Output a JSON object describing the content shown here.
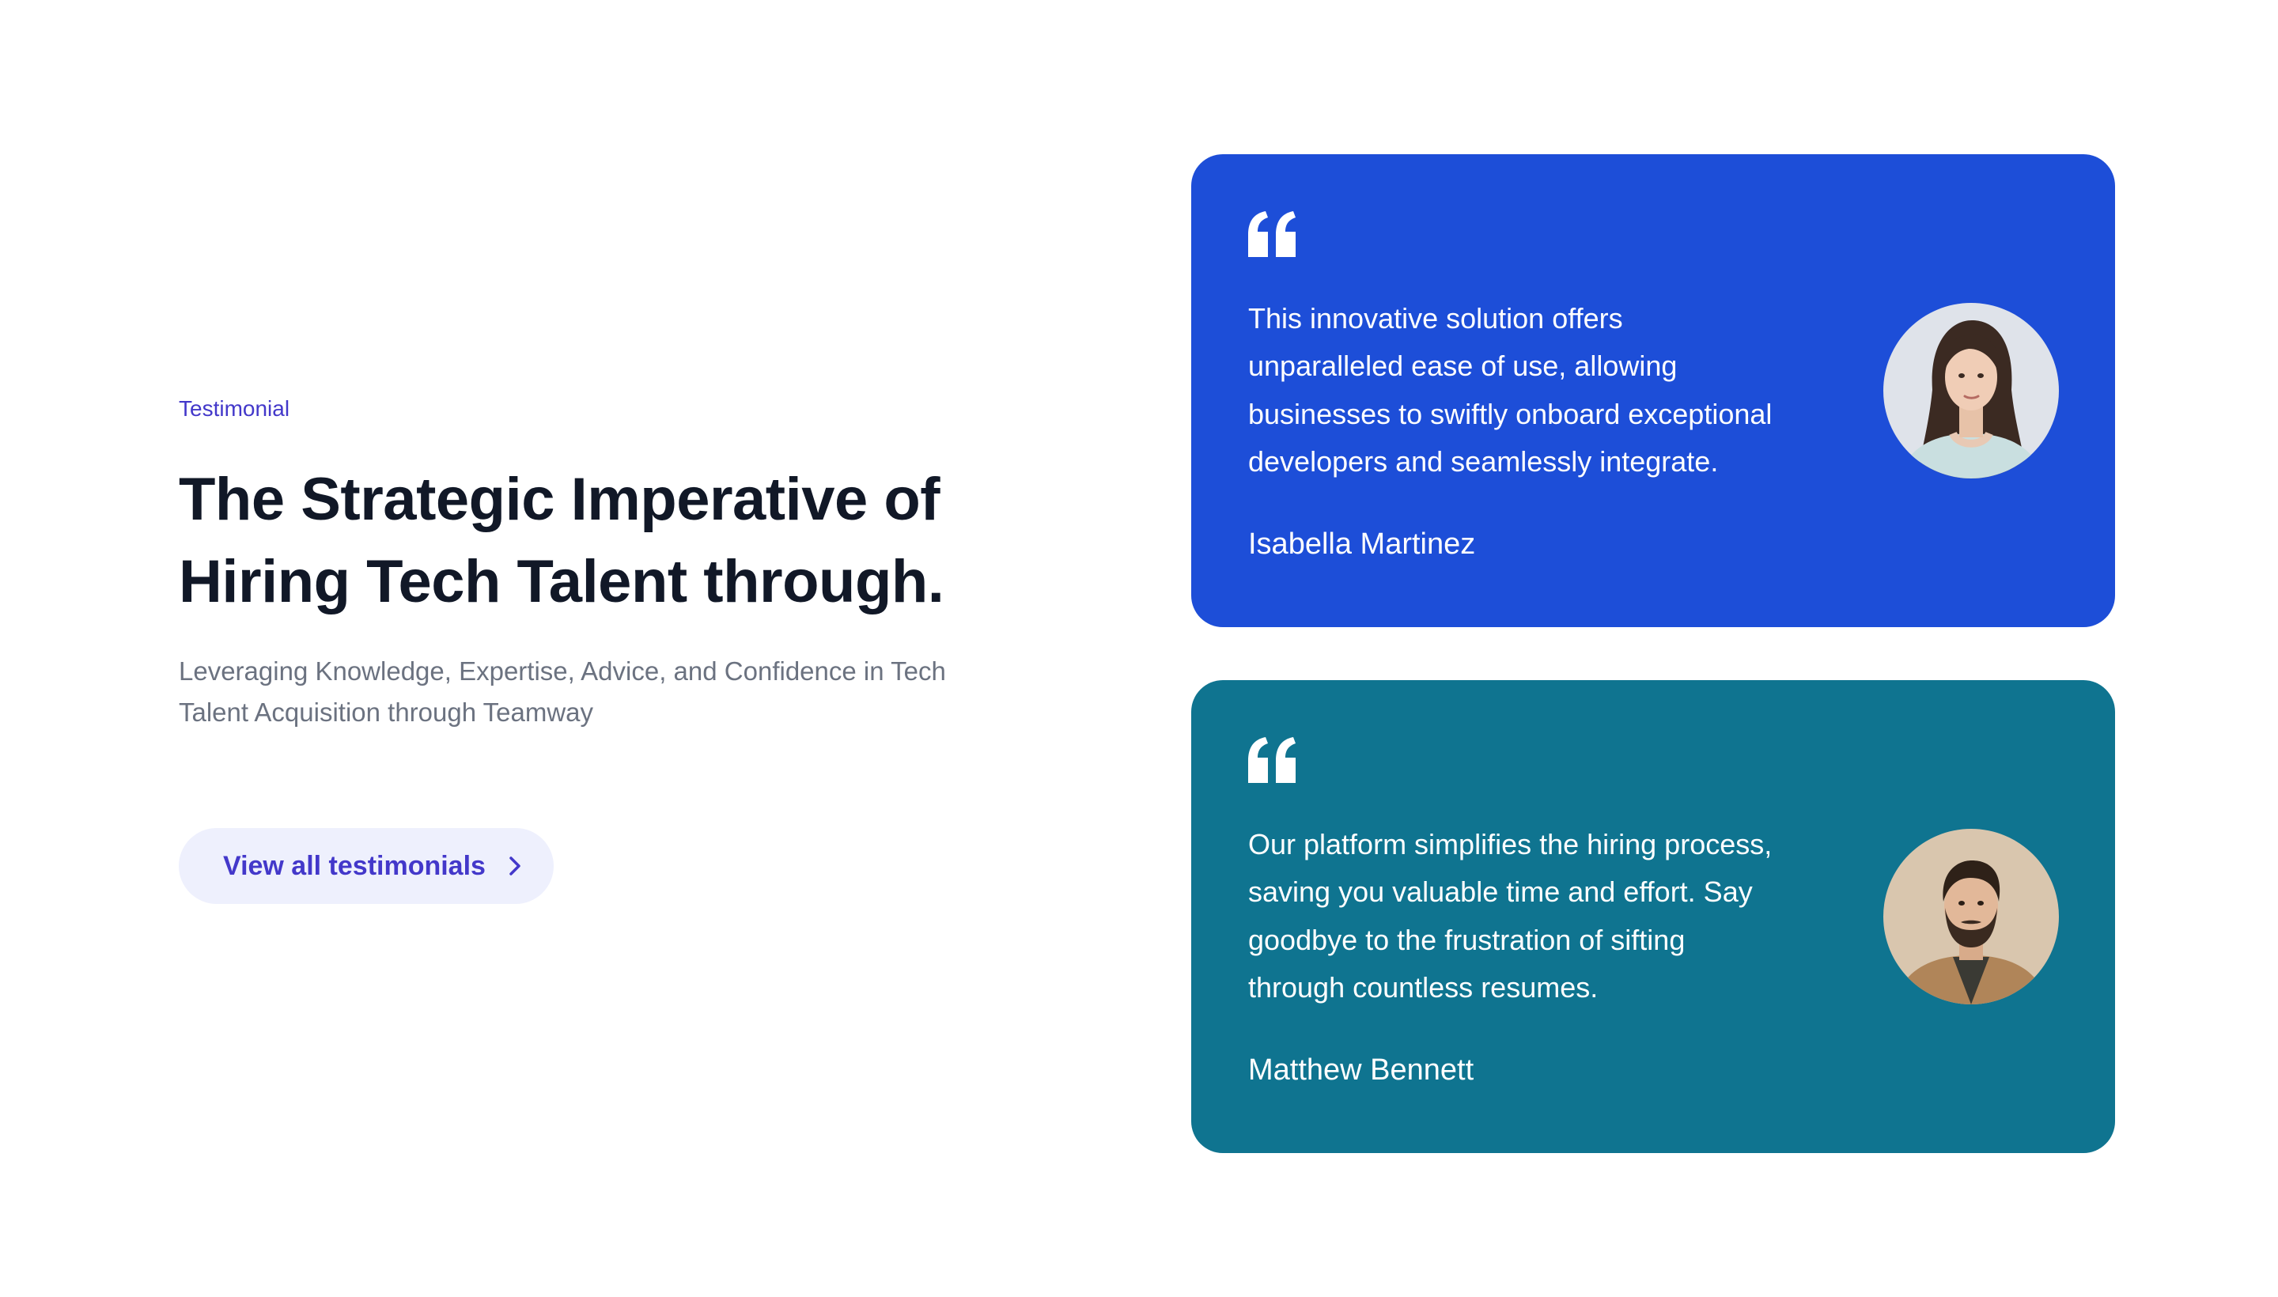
{
  "section": {
    "eyebrow": "Testimonial",
    "heading_line1": "The Strategic Imperative of",
    "heading_line2": "Hiring Tech Talent through.",
    "subtitle_line1": "Leveraging Knowledge, Expertise, Advice, and Confidence in Tech",
    "subtitle_line2": "Talent Acquisition through Teamway",
    "cta_label": "View all testimonials",
    "cta_icon": "chevron-right-icon"
  },
  "testimonials": [
    {
      "quote_line1": "This innovative solution offers",
      "quote_line2": "unparalleled ease of use, allowing",
      "quote_line3": "businesses to swiftly onboard exceptional",
      "quote_line4": "developers and seamlessly integrate.",
      "author": "Isabella Martinez",
      "background": "#1d4ed8",
      "icon": "quote-icon"
    },
    {
      "quote_line1": "Our platform simplifies the hiring process,",
      "quote_line2": "saving you valuable time and effort. Say",
      "quote_line3": "goodbye to the frustration of sifting",
      "quote_line4": "through countless resumes.",
      "author": "Matthew Bennett",
      "background": "#0f7490",
      "icon": "quote-icon"
    }
  ],
  "colors": {
    "accent": "#4338ca",
    "heading": "#111827",
    "muted": "#6b7280",
    "cta_bg": "#eef0fd"
  }
}
